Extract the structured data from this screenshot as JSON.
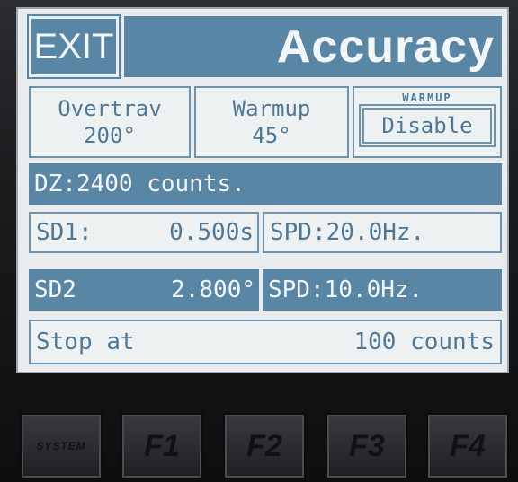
{
  "header": {
    "exit_label": "EXIT",
    "title": "Accuracy"
  },
  "settings": {
    "overtrav": {
      "label": "Overtrav",
      "value": "200°"
    },
    "warmup": {
      "label": "Warmup",
      "value": "45°"
    },
    "warmup_toggle": {
      "label": "WARMUP",
      "button": "Disable"
    }
  },
  "rows": {
    "dz": "DZ:2400 counts.",
    "sd1": {
      "label": "SD1:",
      "value": "0.500s"
    },
    "spd1": "SPD:20.0Hz.",
    "sd2": {
      "label": "SD2",
      "value": "2.800°"
    },
    "spd2": "SPD:10.0Hz.",
    "stop": {
      "label": "Stop at",
      "value": "100 counts"
    }
  },
  "keys": {
    "system": "SYSTEM",
    "f1": "F1",
    "f2": "F2",
    "f3": "F3",
    "f4": "F4"
  },
  "colors": {
    "lcd_dark": "#5a86a6",
    "lcd_light": "#eef1f2",
    "lcd_text": "#4f7897"
  }
}
